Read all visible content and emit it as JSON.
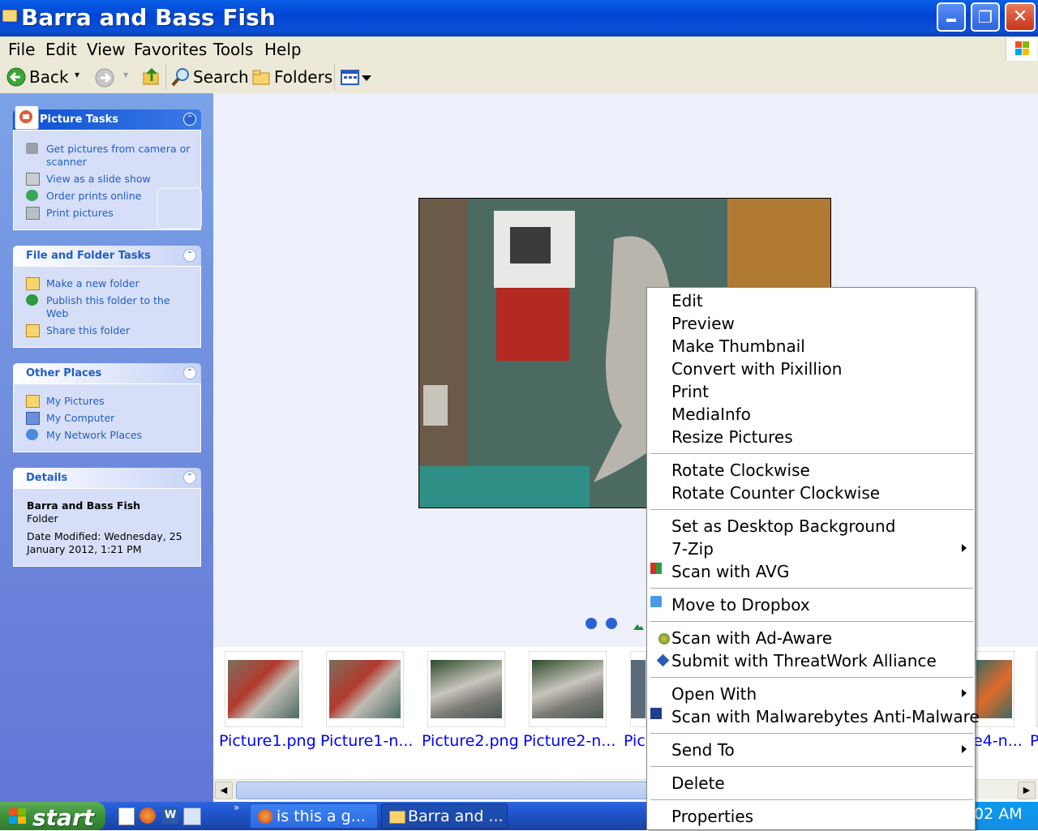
{
  "window": {
    "title": "Barra and Bass Fish",
    "minimize_glyph": "_",
    "maximize_glyph": "❐",
    "close_glyph": "✕"
  },
  "menubar": [
    "File",
    "Edit",
    "View",
    "Favorites",
    "Tools",
    "Help"
  ],
  "toolbar": {
    "back": "Back",
    "search": "Search",
    "folders": "Folders"
  },
  "sidebar": {
    "picture_tasks": {
      "title": "Picture Tasks",
      "items": [
        "Get pictures from camera or scanner",
        "View as a slide show",
        "Order prints online",
        "Print pictures"
      ]
    },
    "file_folder_tasks": {
      "title": "File and Folder Tasks",
      "items": [
        "Make a new folder",
        "Publish this folder to the Web",
        "Share this folder"
      ]
    },
    "other_places": {
      "title": "Other Places",
      "items": [
        "My Pictures",
        "My Computer",
        "My Network Places"
      ]
    },
    "details": {
      "title": "Details",
      "name": "Barra and Bass Fish",
      "type": "Folder",
      "modified": "Date Modified: Wednesday, 25 January 2012, 1:21 PM"
    }
  },
  "filmstrip": {
    "labels": [
      "Picture1.png",
      "Picture1-n...",
      "Picture2.png",
      "Picture2-n...",
      "Pic",
      "e4-n...",
      "P"
    ]
  },
  "context_menu": {
    "items": [
      "Edit",
      "Preview",
      "Make Thumbnail",
      "Convert with Pixillion",
      "Print",
      "MediaInfo",
      "Resize Pictures",
      "Rotate Clockwise",
      "Rotate Counter Clockwise",
      "Set as Desktop Background",
      "7-Zip",
      "Scan with AVG",
      "Move to Dropbox",
      "Scan with Ad-Aware",
      "Submit with ThreatWork Alliance",
      "Open With",
      "Scan with Malwarebytes Anti-Malware",
      "Send To",
      "Delete",
      "Properties"
    ]
  },
  "taskbar": {
    "start": "start",
    "tasks": [
      "is this a g...",
      "Barra and ..."
    ],
    "clock": "02 AM",
    "chevron": "»"
  },
  "colors": {
    "titlebar": "#0a5fe6",
    "sidebar": "#7ba2e7",
    "link": "#215dc6",
    "taskbar": "#245edb",
    "start": "#3c8f3a"
  }
}
